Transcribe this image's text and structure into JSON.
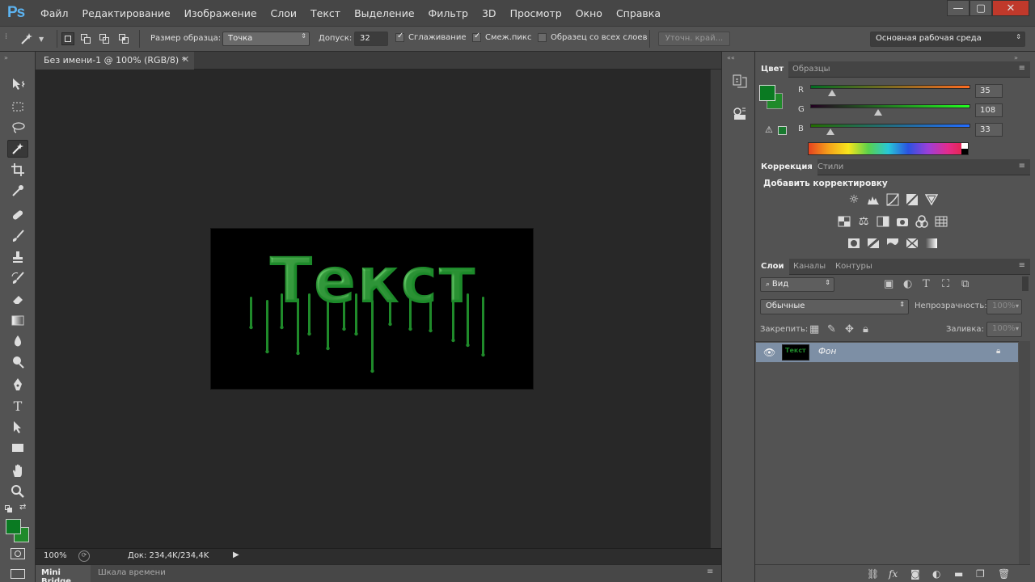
{
  "app": {
    "logo": "Ps"
  },
  "menu": [
    "Файл",
    "Редактирование",
    "Изображение",
    "Слои",
    "Текст",
    "Выделение",
    "Фильтр",
    "3D",
    "Просмотр",
    "Окно",
    "Справка"
  ],
  "window_controls": {
    "minimize": "—",
    "restore": "▢",
    "close": "✕"
  },
  "options": {
    "sample_size_label": "Размер образца:",
    "sample_size_value": "Точка",
    "tolerance_label": "Допуск:",
    "tolerance_value": "32",
    "antialias_label": "Сглаживание",
    "antialias_checked": true,
    "contiguous_label": "Смеж.пикс",
    "contiguous_checked": true,
    "sample_all_label": "Образец со всех слоев",
    "sample_all_checked": false,
    "refine_edge": "Уточн. край...",
    "workspace": "Основная рабочая среда"
  },
  "document": {
    "tab_title": "Без имени-1 @ 100% (RGB/8) *",
    "canvas_text": "Текст",
    "text_color": "#1f8a2a",
    "zoom": "100%",
    "doc_size": "Док: 234,4K/234,4K"
  },
  "bottom_tabs": [
    "Mini Bridge",
    "Шкала времени"
  ],
  "color_panel": {
    "tabs": [
      "Цвет",
      "Образцы"
    ],
    "foreground": "#0a7a22",
    "background": "#1f8a2a",
    "channels": [
      {
        "label": "R",
        "value": "35"
      },
      {
        "label": "G",
        "value": "108"
      },
      {
        "label": "B",
        "value": "33"
      }
    ]
  },
  "adjustments_panel": {
    "tabs": [
      "Коррекция",
      "Стили"
    ],
    "title": "Добавить корректировку"
  },
  "layers_panel": {
    "tabs": [
      "Слои",
      "Каналы",
      "Контуры"
    ],
    "filter_kind": "Вид",
    "blend_mode": "Обычные",
    "opacity_label": "Непрозрачность:",
    "opacity_value": "100%",
    "lock_label": "Закрепить:",
    "fill_label": "Заливка:",
    "fill_value": "100%",
    "layers": [
      {
        "name": "Фон",
        "thumb_text": "Текст",
        "visible": true,
        "locked": true
      }
    ]
  }
}
